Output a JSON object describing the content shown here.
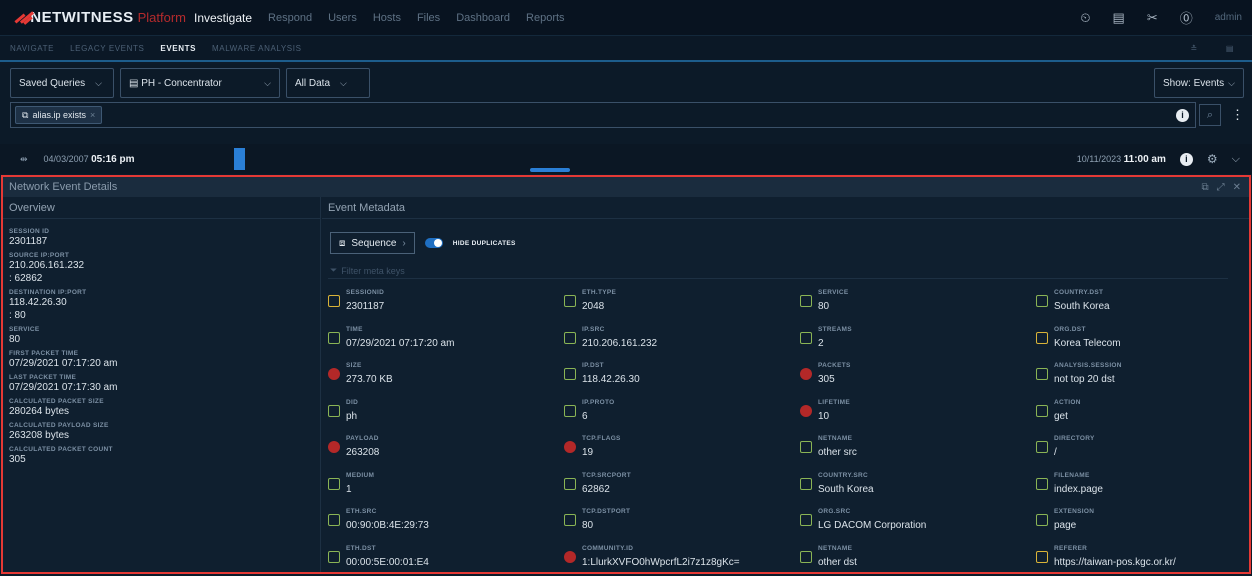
{
  "brand": {
    "name": "NETWITNESS",
    "sub": "Platform"
  },
  "topnav": [
    "Investigate",
    "Respond",
    "Users",
    "Hosts",
    "Files",
    "Dashboard",
    "Reports"
  ],
  "user": "admin",
  "subnav": [
    "NAVIGATE",
    "LEGACY EVENTS",
    "EVENTS",
    "MALWARE ANALYSIS"
  ],
  "query": {
    "saved_queries": "Saved Queries",
    "service": "PH - Concentrator",
    "range": "All Data",
    "show": "Show: Events",
    "filter_pill": "alias.ip exists"
  },
  "timeline": {
    "start_date": "04/03/2007",
    "start_time": "05:16 pm",
    "end_date": "10/11/2023",
    "end_time": "11:00 am"
  },
  "panel": {
    "title": "Network Event Details",
    "overview_title": "Overview",
    "meta_title": "Event Metadata",
    "sequence": "Sequence",
    "hide_duplicates": "HIDE DUPLICATES",
    "filter_placeholder": "Filter meta keys"
  },
  "overview": [
    {
      "label": "SESSION ID",
      "values": [
        "2301187"
      ]
    },
    {
      "label": "SOURCE IP:PORT",
      "values": [
        "210.206.161.232",
        ": 62862"
      ]
    },
    {
      "label": "DESTINATION IP:PORT",
      "values": [
        "118.42.26.30",
        ": 80"
      ]
    },
    {
      "label": "SERVICE",
      "values": [
        "80"
      ]
    },
    {
      "label": "FIRST PACKET TIME",
      "values": [
        "07/29/2021 07:17:20 am"
      ]
    },
    {
      "label": "LAST PACKET TIME",
      "values": [
        "07/29/2021 07:17:30 am"
      ]
    },
    {
      "label": "CALCULATED PACKET SIZE",
      "values": [
        "280264 bytes"
      ]
    },
    {
      "label": "CALCULATED PAYLOAD SIZE",
      "values": [
        "263208 bytes"
      ]
    },
    {
      "label": "CALCULATED PACKET COUNT",
      "values": [
        "305"
      ]
    }
  ],
  "metadata": [
    {
      "key": "SESSIONID",
      "value": "2301187",
      "icon": "y"
    },
    {
      "key": "ETH.TYPE",
      "value": "2048",
      "icon": "g"
    },
    {
      "key": "SERVICE",
      "value": "80",
      "icon": "g"
    },
    {
      "key": "COUNTRY.DST",
      "value": "South Korea",
      "icon": "g"
    },
    {
      "key": "TIME",
      "value": "07/29/2021 07:17:20 am",
      "icon": "g"
    },
    {
      "key": "IP.SRC",
      "value": "210.206.161.232",
      "icon": "g"
    },
    {
      "key": "STREAMS",
      "value": "2",
      "icon": "g"
    },
    {
      "key": "ORG.DST",
      "value": "Korea Telecom",
      "icon": "y"
    },
    {
      "key": "SIZE",
      "value": "273.70 KB",
      "icon": "r"
    },
    {
      "key": "IP.DST",
      "value": "118.42.26.30",
      "icon": "g"
    },
    {
      "key": "PACKETS",
      "value": "305",
      "icon": "r"
    },
    {
      "key": "ANALYSIS.SESSION",
      "value": "not top 20 dst",
      "icon": "g"
    },
    {
      "key": "DID",
      "value": "ph",
      "icon": "g"
    },
    {
      "key": "IP.PROTO",
      "value": "6",
      "icon": "g"
    },
    {
      "key": "LIFETIME",
      "value": "10",
      "icon": "r"
    },
    {
      "key": "ACTION",
      "value": "get",
      "icon": "g"
    },
    {
      "key": "PAYLOAD",
      "value": "263208",
      "icon": "r"
    },
    {
      "key": "TCP.FLAGS",
      "value": "19",
      "icon": "r"
    },
    {
      "key": "NETNAME",
      "value": "other src",
      "icon": "g"
    },
    {
      "key": "DIRECTORY",
      "value": "/",
      "icon": "g"
    },
    {
      "key": "MEDIUM",
      "value": "1",
      "icon": "g"
    },
    {
      "key": "TCP.SRCPORT",
      "value": "62862",
      "icon": "g"
    },
    {
      "key": "COUNTRY.SRC",
      "value": "South Korea",
      "icon": "g"
    },
    {
      "key": "FILENAME",
      "value": "index.page",
      "icon": "g"
    },
    {
      "key": "ETH.SRC",
      "value": "00:90:0B:4E:29:73",
      "icon": "g"
    },
    {
      "key": "TCP.DSTPORT",
      "value": "80",
      "icon": "g"
    },
    {
      "key": "ORG.SRC",
      "value": "LG DACOM Corporation",
      "icon": "g"
    },
    {
      "key": "EXTENSION",
      "value": "page",
      "icon": "g"
    },
    {
      "key": "ETH.DST",
      "value": "00:00:5E:00:01:E4",
      "icon": "g"
    },
    {
      "key": "COMMUNITY.ID",
      "value": "1:LlurkXVFO0hWpcrfL2i7z1z8gKc=",
      "icon": "r"
    },
    {
      "key": "NETNAME",
      "value": "other dst",
      "icon": "g"
    },
    {
      "key": "REFERER",
      "value": "https://taiwan-pos.kgc.or.kr/",
      "icon": "y"
    }
  ]
}
